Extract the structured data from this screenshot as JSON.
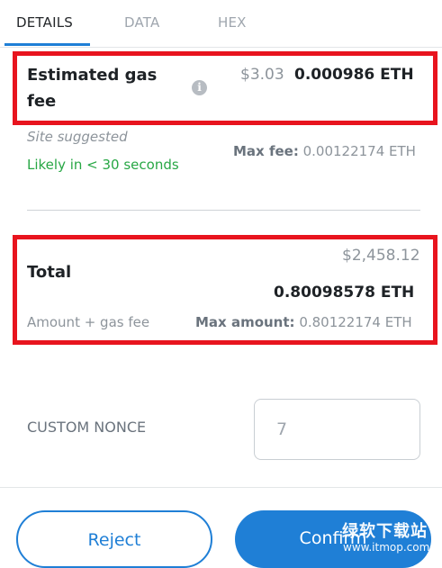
{
  "tabs": [
    {
      "label": "DETAILS",
      "active": true
    },
    {
      "label": "DATA",
      "active": false
    },
    {
      "label": "HEX",
      "active": false
    }
  ],
  "gas": {
    "label_line1": "Estimated gas",
    "label_line2": "fee",
    "fiat": "$3.03",
    "eth": "0.000986 ETH",
    "site_suggested": "Site suggested",
    "likely": "Likely in < 30 seconds",
    "max_fee_label": "Max fee:",
    "max_fee_value": "0.00122174 ETH"
  },
  "total": {
    "label": "Total",
    "fiat": "$2,458.12",
    "eth": "0.80098578 ETH",
    "sublabel": "Amount + gas fee",
    "max_amount_label": "Max amount:",
    "max_amount_value": "0.80122174 ETH"
  },
  "nonce": {
    "label": "CUSTOM NONCE",
    "placeholder": "7"
  },
  "buttons": {
    "reject": "Reject",
    "confirm": "Confirm"
  },
  "watermark": {
    "line1": "绿软下载站",
    "line2": "www.itmop.com"
  },
  "colors": {
    "accent": "#1f7fd6",
    "highlight_box": "#e8141e",
    "success": "#28a745"
  }
}
